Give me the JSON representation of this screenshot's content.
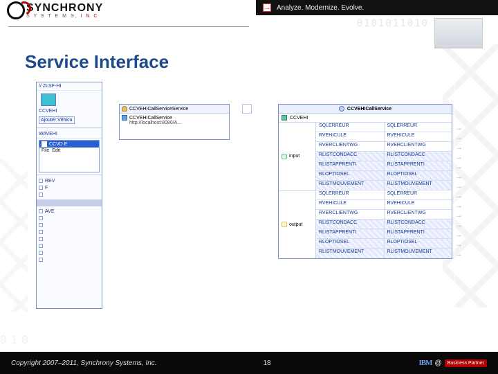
{
  "brand": {
    "name": "SYNCHRONY",
    "sub1": "S Y S T E M S, ",
    "sub2": "I N C"
  },
  "tagline": "Analyze. Modernize. Evolve.",
  "digits": "0101011010",
  "bg_binary": "010",
  "slide_title": "Service Interface",
  "left": {
    "topcode": "// ZLSF-HI",
    "chip": "CCVEHI",
    "btn_add": "Ajouter Véhicu",
    "section2": "WAVEHI",
    "win": "CCVD E",
    "menu_file": "File",
    "menu_edit": "Edit",
    "row_rev": "REV",
    "row_f": "F",
    "row_ave": "AVE"
  },
  "svc_def": {
    "title": "CCVEHICallServiceService",
    "impl": "CCVEHICallService",
    "url": "http://localhost:8080/A..."
  },
  "svc_table": {
    "title": "CCVEHICallService",
    "unit": "CCVEHI",
    "io_input": "input",
    "io_output": "output",
    "rows_in": [
      "SQLERREUR",
      "RVEHICULE",
      "RVERCLIENTWG",
      "RLISTCONDACC",
      "RLISTAPPRENTI",
      "RLOPTIOSEL",
      "RLISTMOUVEMENT"
    ],
    "rows_out": [
      "SQLERREUR",
      "RVEHICULE",
      "RVERCLIENTWG",
      "RLISTCONDACC",
      "RLISTAPPRENTI",
      "RLOPTIOSEL",
      "RLISTMOUVEMENT"
    ]
  },
  "footer": {
    "copyright": "Copyright 2007–2011, Synchrony Systems, Inc.",
    "page": "18",
    "ibm": "IBM",
    "bp": "Business\nPartner"
  }
}
